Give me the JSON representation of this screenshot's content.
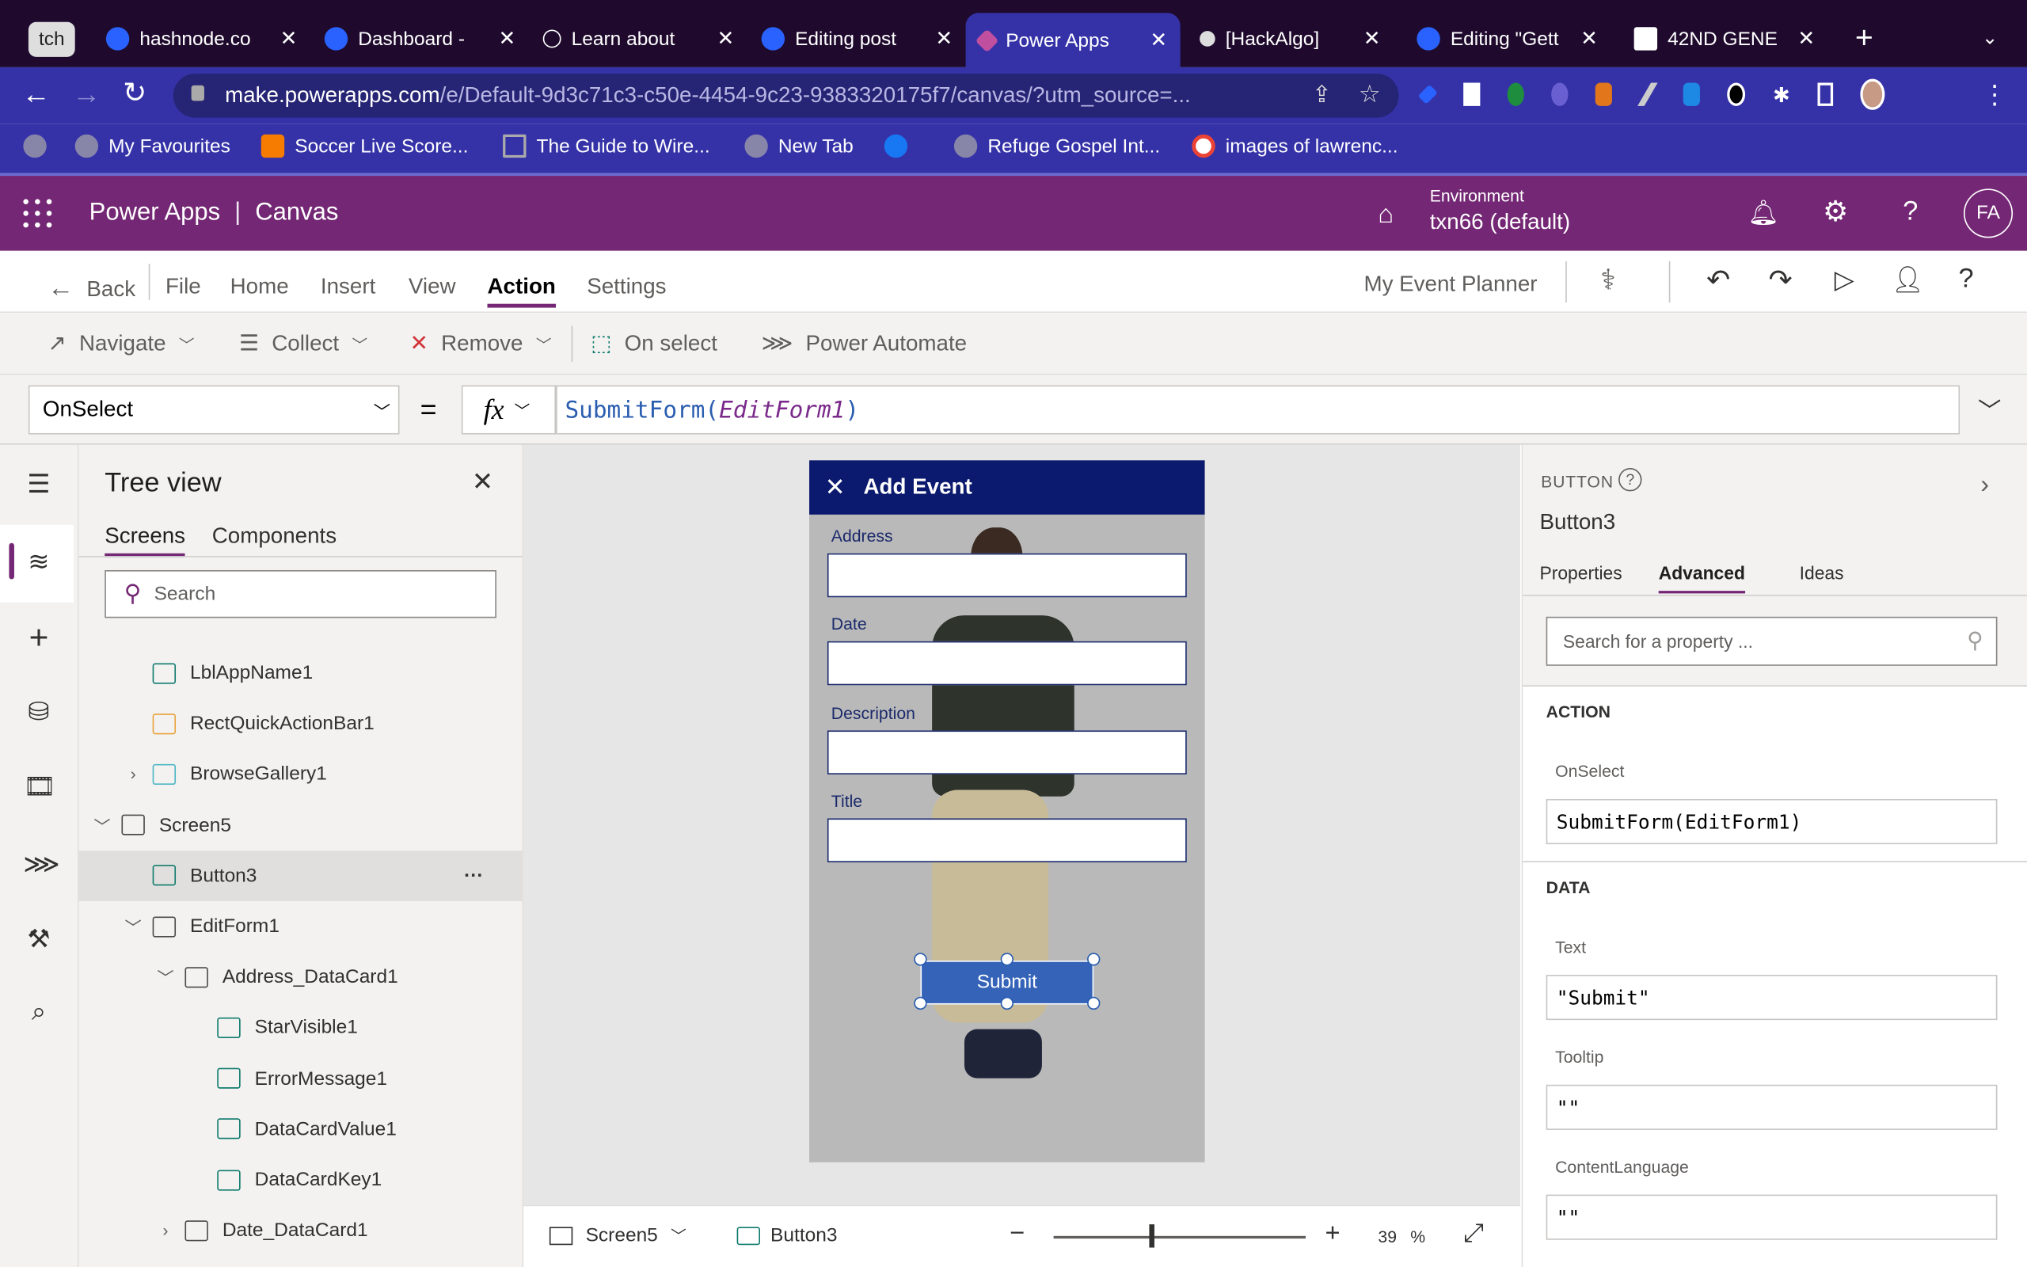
{
  "browser": {
    "tabs": [
      {
        "label": "tch"
      },
      {
        "label": "hashnode.co"
      },
      {
        "label": "Dashboard -"
      },
      {
        "label": "Learn about"
      },
      {
        "label": "Editing post"
      },
      {
        "label": "Power Apps",
        "active": true
      },
      {
        "label": "[HackAlgo]"
      },
      {
        "label": "Editing \"Gett"
      },
      {
        "label": "42ND GENE"
      }
    ],
    "url_host": "make.powerapps.com",
    "url_path": "/e/Default-9d3c71c3-c50e-4454-9c23-9383320175f7/canvas/?utm_source=...",
    "bookmarks": [
      "My Favourites",
      "Soccer Live Score...",
      "The Guide to Wire...",
      "New Tab",
      "Refuge Gospel Int...",
      "images of lawrenc..."
    ]
  },
  "app": {
    "name": "Power Apps",
    "section": "Canvas",
    "env_label": "Environment",
    "env_value": "txn66 (default)",
    "avatar": "FA",
    "brand_color": "#742774"
  },
  "menu": {
    "back": "Back",
    "items": [
      "File",
      "Home",
      "Insert",
      "View",
      "Action",
      "Settings"
    ],
    "active": "Action",
    "app_title": "My Event Planner"
  },
  "ribbon": {
    "items": [
      "Navigate",
      "Collect",
      "Remove",
      "On select",
      "Power Automate"
    ]
  },
  "formula": {
    "property": "OnSelect",
    "eq": "=",
    "fx": "fx",
    "func": "SubmitForm(",
    "arg": "EditForm1",
    "close": ")"
  },
  "tree": {
    "title": "Tree view",
    "tabs": [
      "Screens",
      "Components"
    ],
    "search_placeholder": "Search",
    "items": [
      {
        "label": "LblAppName1",
        "indent": 2,
        "icon": "label-icon"
      },
      {
        "label": "RectQuickActionBar1",
        "indent": 2,
        "icon": "shapes-icon"
      },
      {
        "label": "BrowseGallery1",
        "indent": 2,
        "icon": "gallery-icon",
        "chevron": ">"
      },
      {
        "label": "Screen5",
        "indent": 1,
        "icon": "screen-icon",
        "chevron": "v"
      },
      {
        "label": "Button3",
        "indent": 2,
        "icon": "button-icon",
        "selected": true
      },
      {
        "label": "EditForm1",
        "indent": 2,
        "icon": "form-icon",
        "chevron": "v"
      },
      {
        "label": "Address_DataCard1",
        "indent": 3,
        "icon": "card-icon",
        "chevron": "v"
      },
      {
        "label": "StarVisible1",
        "indent": 4,
        "icon": "label-icon"
      },
      {
        "label": "ErrorMessage1",
        "indent": 4,
        "icon": "label-icon"
      },
      {
        "label": "DataCardValue1",
        "indent": 4,
        "icon": "textinput-icon"
      },
      {
        "label": "DataCardKey1",
        "indent": 4,
        "icon": "label-icon"
      },
      {
        "label": "Date_DataCard1",
        "indent": 3,
        "icon": "card-icon",
        "chevron": ">"
      }
    ],
    "more": "···"
  },
  "phone": {
    "header": "Add Event",
    "fields": [
      "Address",
      "Date",
      "Description",
      "Title"
    ],
    "button": "Submit",
    "header_color": "#0b1a6e",
    "button_color": "#3563b8"
  },
  "status": {
    "screen": "Screen5",
    "control": "Button3",
    "zoom": "39",
    "zoom_unit": "%",
    "zoom_level": 39
  },
  "props": {
    "type": "BUTTON",
    "name": "Button3",
    "tabs": [
      "Properties",
      "Advanced",
      "Ideas"
    ],
    "active_tab": "Advanced",
    "search_placeholder": "Search for a property ...",
    "action_section": "ACTION",
    "onselect_label": "OnSelect",
    "onselect_value": "SubmitForm(EditForm1)",
    "data_section": "DATA",
    "text_label": "Text",
    "text_value": "\"Submit\"",
    "tooltip_label": "Tooltip",
    "tooltip_value": "\"\"",
    "lang_label": "ContentLanguage",
    "lang_value": "\"\""
  }
}
